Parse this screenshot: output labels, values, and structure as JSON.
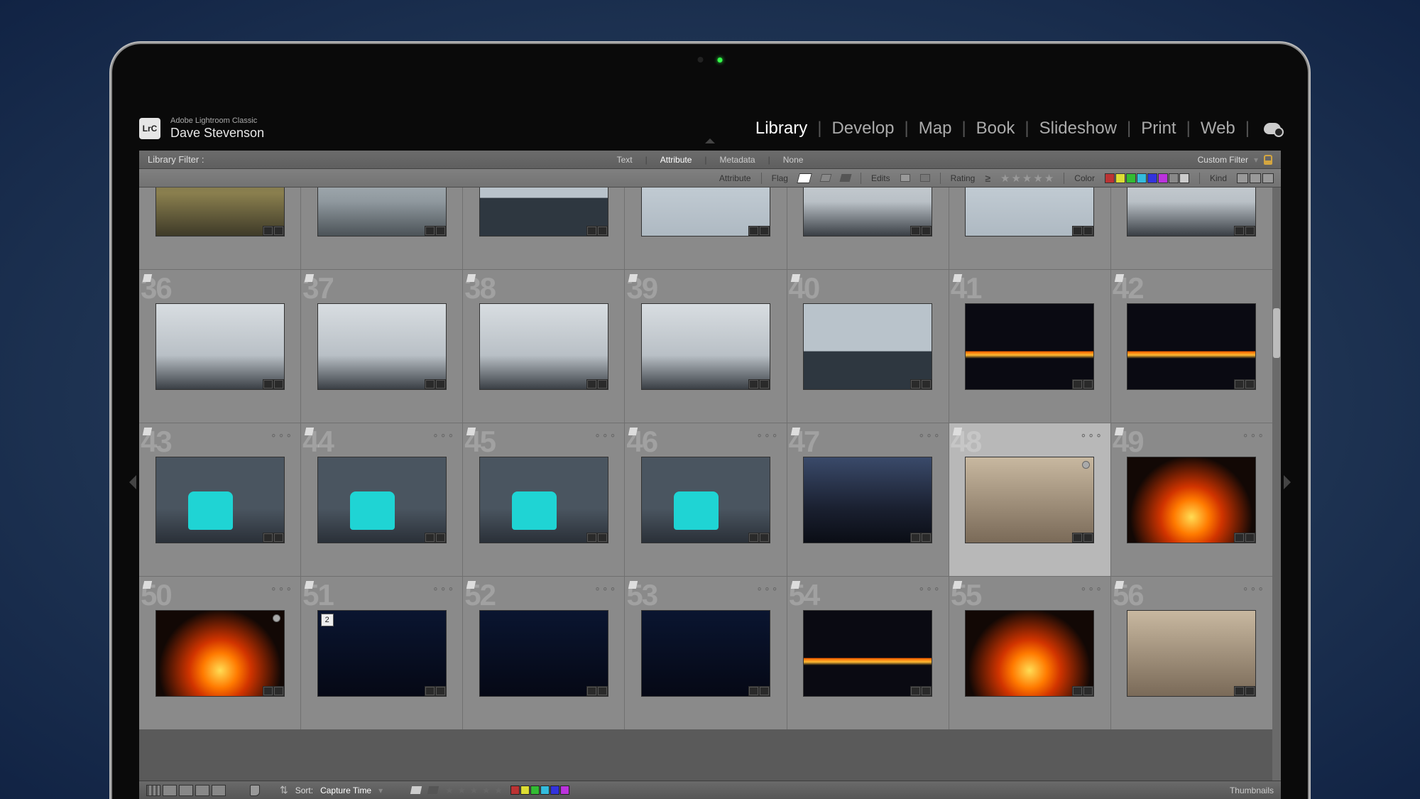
{
  "brand": {
    "logo_text": "LrC",
    "app_name": "Adobe Lightroom Classic",
    "user_name": "Dave Stevenson"
  },
  "modules": {
    "items": [
      "Library",
      "Develop",
      "Map",
      "Book",
      "Slideshow",
      "Print",
      "Web"
    ],
    "active": "Library"
  },
  "filter_bar": {
    "label": "Library Filter :",
    "tabs": [
      "Text",
      "Attribute",
      "Metadata",
      "None"
    ],
    "active_tab": "Attribute",
    "custom_label": "Custom Filter"
  },
  "attr_bar": {
    "attribute_label": "Attribute",
    "flag_label": "Flag",
    "edits_label": "Edits",
    "rating_label": "Rating",
    "rating_op": "≥",
    "color_label": "Color",
    "colors": [
      "#b33",
      "#dd3",
      "#3b3",
      "#3bd",
      "#33d",
      "#b3d",
      "#888",
      "#ccc"
    ],
    "kind_label": "Kind"
  },
  "grid": {
    "start_index": 29,
    "row0_style": [
      "rocks",
      "water",
      "people",
      "sky",
      "fog",
      "sky",
      "fog"
    ],
    "row1_style": [
      "fog",
      "fog",
      "fog",
      "fog",
      "people",
      "lava2",
      "lava2"
    ],
    "row2_style": [
      "cyan-people",
      "cyan-people",
      "cyan-people",
      "cyan-people",
      "dusk",
      "snowview",
      "lava"
    ],
    "row3_style": [
      "lava",
      "night",
      "night",
      "night",
      "lava2",
      "lava",
      "snowview"
    ],
    "selected_index": 48,
    "stack_count": "2"
  },
  "footer": {
    "sort_label": "Sort:",
    "sort_value": "Capture Time",
    "view_label": "Thumbnails",
    "colors": [
      "#b33",
      "#dd3",
      "#3b3",
      "#3bd",
      "#33d",
      "#b3d"
    ]
  }
}
